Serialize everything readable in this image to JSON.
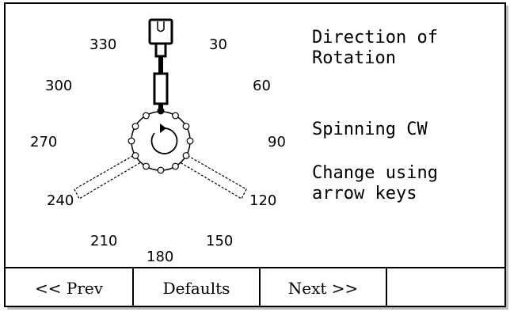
{
  "degree_labels": [
    "330",
    "30",
    "300",
    "60",
    "270",
    "90",
    "240",
    "120",
    "210",
    "150",
    "180"
  ],
  "info": {
    "title": "Direction of\nRotation",
    "status": "Spinning CW",
    "hint": "Change using\narrow keys"
  },
  "softkeys": [
    "<< Prev",
    "Defaults",
    "Next >>",
    ""
  ]
}
